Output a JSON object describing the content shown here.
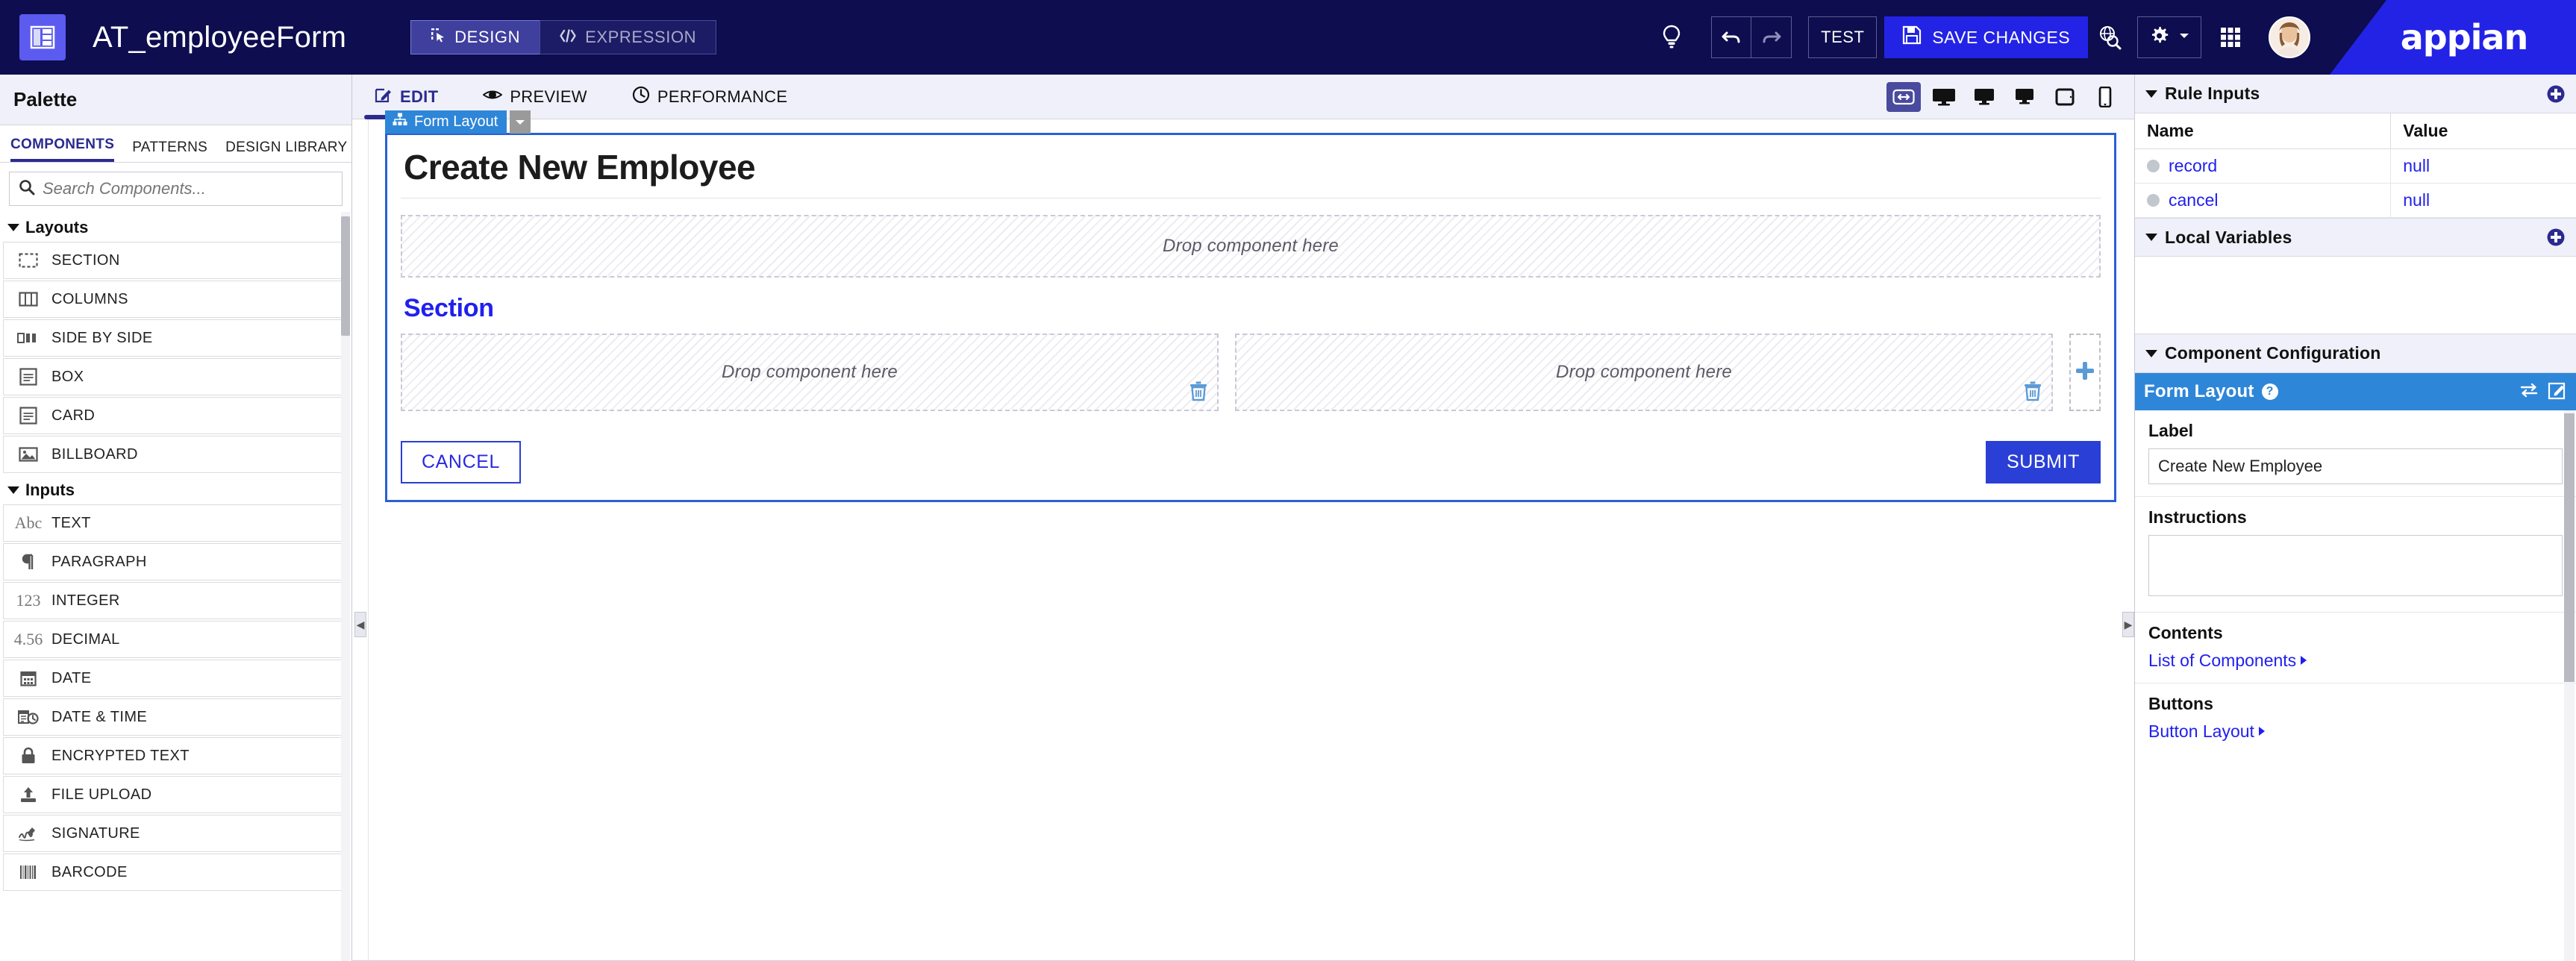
{
  "header": {
    "app_icon": "form-layout-icon",
    "title": "AT_employeeForm",
    "modes": [
      {
        "label": "DESIGN",
        "icon": "design-cursor-icon",
        "active": true
      },
      {
        "label": "EXPRESSION",
        "icon": "code-brackets-icon",
        "active": false
      }
    ],
    "tip_icon": "lightbulb-icon",
    "undo_icon": "undo-arrow-icon",
    "redo_icon": "redo-arrow-icon",
    "test_label": "TEST",
    "save_label": "SAVE CHANGES",
    "save_icon": "floppy-disk-icon",
    "save_color": "#2323e6",
    "globe_search_icon": "globe-search-icon",
    "gear_icon": "gear-icon",
    "gear_caret_icon": "chevron-down-icon",
    "apps_grid_icon": "apps-grid-icon",
    "avatar": "user-avatar",
    "logo_text": "appian",
    "logo_color": "#2323e6",
    "bar_color": "#0d0d4f"
  },
  "palette": {
    "title": "Palette",
    "tabs": [
      {
        "label": "COMPONENTS",
        "active": true
      },
      {
        "label": "PATTERNS",
        "active": false
      },
      {
        "label": "DESIGN LIBRARY",
        "active": false
      }
    ],
    "search": {
      "placeholder": "Search Components...",
      "value": "",
      "icon": "search-icon"
    },
    "groups": [
      {
        "name": "Layouts",
        "expanded": true,
        "items": [
          {
            "label": "SECTION",
            "icon": "dashed-rect-icon"
          },
          {
            "label": "COLUMNS",
            "icon": "columns-icon"
          },
          {
            "label": "SIDE BY SIDE",
            "icon": "side-by-side-icon"
          },
          {
            "label": "BOX",
            "icon": "box-icon"
          },
          {
            "label": "CARD",
            "icon": "card-icon"
          },
          {
            "label": "BILLBOARD",
            "icon": "billboard-image-icon"
          }
        ]
      },
      {
        "name": "Inputs",
        "expanded": true,
        "items": [
          {
            "label": "TEXT",
            "icon": "abc-text-icon",
            "glyph": "Abc"
          },
          {
            "label": "PARAGRAPH",
            "icon": "pilcrow-icon",
            "glyph": "¶"
          },
          {
            "label": "INTEGER",
            "icon": "integer-123-icon",
            "glyph": "123"
          },
          {
            "label": "DECIMAL",
            "icon": "decimal-456-icon",
            "glyph": "4.56"
          },
          {
            "label": "DATE",
            "icon": "calendar-icon"
          },
          {
            "label": "DATE & TIME",
            "icon": "calendar-clock-icon"
          },
          {
            "label": "ENCRYPTED TEXT",
            "icon": "lock-icon"
          },
          {
            "label": "FILE UPLOAD",
            "icon": "file-upload-icon"
          },
          {
            "label": "SIGNATURE",
            "icon": "signature-pen-icon"
          },
          {
            "label": "BARCODE",
            "icon": "barcode-icon"
          }
        ]
      }
    ]
  },
  "center": {
    "tabs": [
      {
        "label": "EDIT",
        "icon": "edit-pencil-icon",
        "active": true
      },
      {
        "label": "PREVIEW",
        "icon": "eye-icon",
        "active": false
      },
      {
        "label": "PERFORMANCE",
        "icon": "clock-icon",
        "active": false
      }
    ],
    "devices": [
      {
        "name": "responsive-width-toggle",
        "icon": "arrows-horizontal-icon",
        "active": true
      },
      {
        "name": "desktop-wide",
        "icon": "monitor-icon",
        "active": false
      },
      {
        "name": "desktop-medium",
        "icon": "monitor-icon",
        "active": false
      },
      {
        "name": "desktop-small",
        "icon": "monitor-icon",
        "active": false
      },
      {
        "name": "tablet",
        "icon": "tablet-icon",
        "active": false
      },
      {
        "name": "phone",
        "icon": "phone-icon",
        "active": false
      }
    ],
    "canvas": {
      "component_tag": {
        "label": "Form Layout",
        "icon": "sitemap-icon",
        "caret": "chevron-down-icon"
      },
      "form_title": "Create New Employee",
      "top_dropzone": "Drop component here",
      "section_label": "Section",
      "columns": [
        {
          "dropzone": "Drop component here",
          "delete_icon": "trash-icon"
        },
        {
          "dropzone": "Drop component here",
          "delete_icon": "trash-icon"
        }
      ],
      "add_column_icon": "plus-icon",
      "cancel_label": "CANCEL",
      "submit_label": "SUBMIT",
      "selection_color": "#2a5fd6"
    }
  },
  "right": {
    "rule_inputs": {
      "title": "Rule Inputs",
      "add_icon": "plus-circle-icon",
      "columns": [
        "Name",
        "Value"
      ],
      "rows": [
        {
          "name": "record",
          "value": "null"
        },
        {
          "name": "cancel",
          "value": "null"
        }
      ]
    },
    "local_variables": {
      "title": "Local Variables",
      "add_icon": "plus-circle-icon"
    },
    "component_configuration": {
      "title": "Component Configuration",
      "selected": {
        "name": "Form Layout",
        "help_icon": "question-mark-icon",
        "swap_icon": "swap-arrows-icon",
        "edit_icon": "edit-square-icon",
        "header_color": "#2e86d8"
      },
      "fields": [
        {
          "label": "Label",
          "type": "input",
          "value": "Create New Employee"
        },
        {
          "label": "Instructions",
          "type": "textarea",
          "value": ""
        },
        {
          "label": "Contents",
          "type": "link",
          "value": "List of Components"
        },
        {
          "label": "Buttons",
          "type": "link",
          "value": "Button Layout"
        }
      ]
    }
  }
}
